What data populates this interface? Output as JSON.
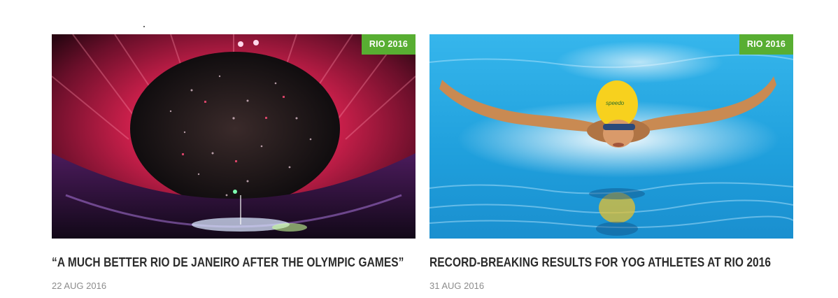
{
  "articles": [
    {
      "badge": "RIO 2016",
      "title": "“A MUCH BETTER RIO DE JANEIRO AFTER THE OLYMPIC GAMES”",
      "date": "22 AUG 2016",
      "image": "stadium-confetti-photo"
    },
    {
      "badge": "RIO 2016",
      "title": "RECORD-BREAKING RESULTS FOR YOG ATHLETES AT RIO 2016",
      "date": "31 AUG 2016",
      "image": "butterfly-swimmer-photo"
    }
  ],
  "colors": {
    "badge_bg": "#58ae32",
    "title_text": "#2b2b2b",
    "date_text": "#8c8c8c"
  }
}
